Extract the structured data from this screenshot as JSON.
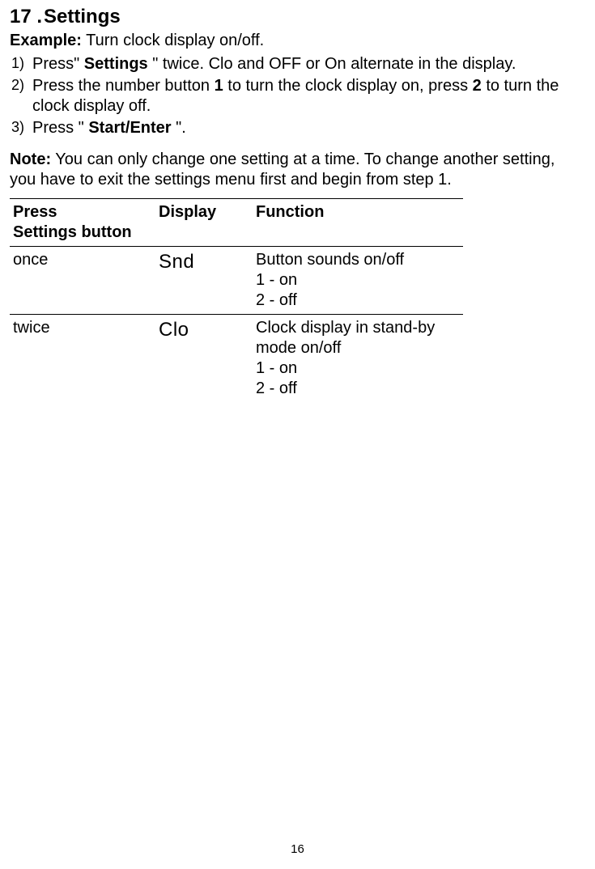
{
  "heading": {
    "number": "17 .",
    "title": "Settings"
  },
  "example": {
    "label": "Example:",
    "text": " Turn clock display on/off."
  },
  "steps": {
    "s1": {
      "marker": "1)",
      "p1": "Press\" ",
      "settings": "Settings",
      "p2": "  \" twice. ",
      "clo": "Clo",
      "p3": " and ",
      "off": "OFF",
      "p4": " or ",
      "on": "On",
      "p5": " alternate in the display."
    },
    "s2": {
      "marker": "2)",
      "p1": "Press the number button ",
      "b1": "1",
      "p2": " to turn the clock display on, press ",
      "b2": "2",
      "p3": " to turn the clock display off."
    },
    "s3": {
      "marker": "3)",
      "p1": "Press  \" ",
      "btn": "Start/Enter",
      "p2": " \"."
    }
  },
  "note": {
    "label": "Note:",
    "text": "  You can only change one setting at a time. To change another setting, you have to exit the settings menu first and begin from step 1."
  },
  "table": {
    "headers": {
      "col1a": "Press",
      "col1b": "Settings button",
      "col2": "Display",
      "col3": "Function"
    },
    "rows": [
      {
        "press": "once",
        "display": "Snd",
        "fn1": "Button sounds on/off",
        "fn2": "1 - on",
        "fn3": "2 - off"
      },
      {
        "press": "twice",
        "display": "Clo",
        "fn1": "Clock display in stand-by mode on/off",
        "fn2": "1 - on",
        "fn3": "2 - off"
      }
    ]
  },
  "pagenum": "16"
}
